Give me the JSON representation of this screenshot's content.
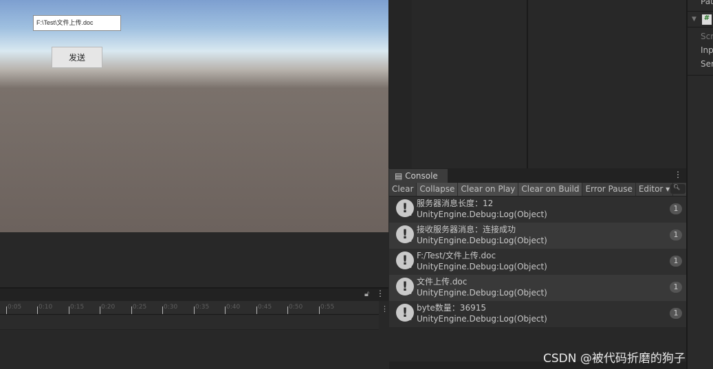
{
  "game": {
    "path_value": "F:\\Test\\文件上传.doc",
    "send_label": "发送"
  },
  "timeline": {
    "ticks": [
      "0:05",
      "0:10",
      "0:15",
      "0:20",
      "0:25",
      "0:30",
      "0:35",
      "0:40",
      "0:45",
      "0:50",
      "0:55"
    ]
  },
  "console": {
    "tab": "Console",
    "toolbar": [
      "Clear",
      "Collapse",
      "Clear on Play",
      "Clear on Build",
      "Error Pause",
      "Editor ▾"
    ],
    "entries": [
      {
        "message": "服务器消息长度：12",
        "trace": "UnityEngine.Debug:Log(Object)",
        "count": "1"
      },
      {
        "message": "接收服务器消息：连接成功",
        "trace": "UnityEngine.Debug:Log(Object)",
        "count": "1"
      },
      {
        "message": "F:/Test/文件上传.doc",
        "trace": "UnityEngine.Debug:Log(Object)",
        "count": "1"
      },
      {
        "message": "文件上传.doc",
        "trace": "UnityEngine.Debug:Log(Object)",
        "count": "1"
      },
      {
        "message": "byte数量：36915",
        "trace": "UnityEngine.Debug:Log(Object)",
        "count": "1"
      }
    ]
  },
  "inspector": {
    "items": [
      "Pat",
      "Scr",
      "Inp",
      "Ser"
    ]
  },
  "watermark": "CSDN @被代码折磨的狗子"
}
